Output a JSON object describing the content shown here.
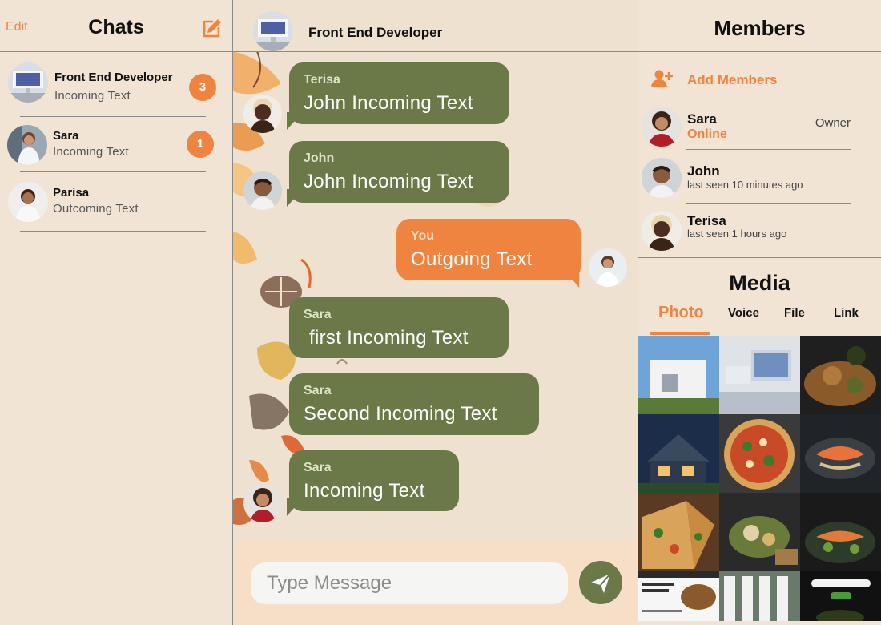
{
  "chats_panel": {
    "edit_label": "Edit",
    "title": "Chats",
    "items": [
      {
        "name": "Front End Developer",
        "sub": "Incoming Text",
        "badge": "3"
      },
      {
        "name": "Sara",
        "sub": "Incoming Text",
        "badge": "1"
      },
      {
        "name": "Parisa",
        "sub": "Outcoming Text",
        "badge": ""
      }
    ]
  },
  "conversation": {
    "title": "Front End Developer",
    "messages": [
      {
        "sender": "Terisa",
        "text": "John Incoming Text",
        "direction": "in"
      },
      {
        "sender": "John",
        "text": "John Incoming Text",
        "direction": "in"
      },
      {
        "sender": "You",
        "text": "Outgoing Text",
        "direction": "out"
      },
      {
        "sender": "Sara",
        "text": "first Incoming Text",
        "direction": "in"
      },
      {
        "sender": "Sara",
        "text": "Second Incoming Text",
        "direction": "in"
      },
      {
        "sender": "Sara",
        "text": "Incoming Text",
        "direction": "in"
      }
    ],
    "input_placeholder": "Type Message"
  },
  "members_panel": {
    "title": "Members",
    "add_label": "Add Members",
    "members": [
      {
        "name": "Sara",
        "status": "Online",
        "role": "Owner"
      },
      {
        "name": "John",
        "status": "last seen 10 minutes ago",
        "role": ""
      },
      {
        "name": "Terisa",
        "status": "last seen 1 hours ago",
        "role": ""
      }
    ]
  },
  "media_panel": {
    "title": "Media",
    "tabs": [
      "Photo",
      "Voice",
      "File",
      "Link"
    ],
    "active_tab": "Photo"
  },
  "icons": {
    "compose": "pencil-square-icon",
    "add_member": "add-user-icon",
    "send": "send-icon"
  },
  "colors": {
    "accent": "#ef8440",
    "incoming_bubble": "#6b7948",
    "background": "#f1e4d5"
  }
}
